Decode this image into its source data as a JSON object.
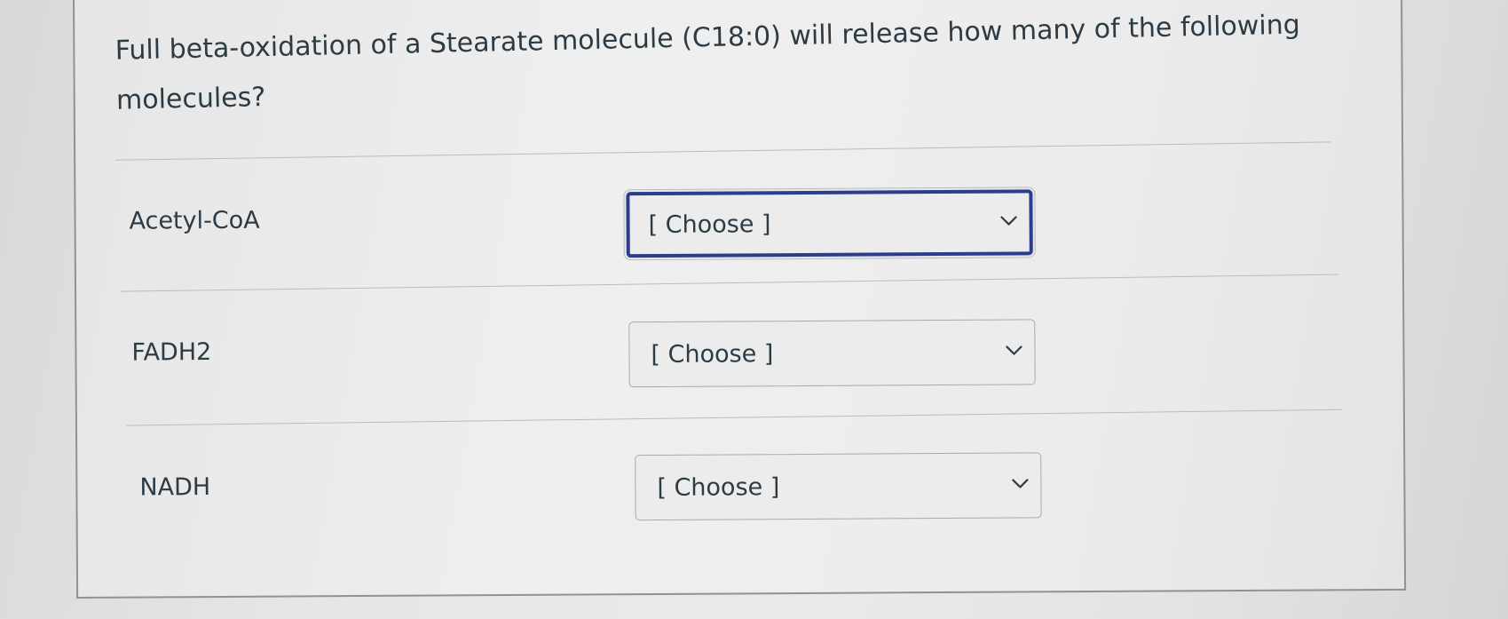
{
  "question": {
    "text": "Full beta-oxidation of a Stearate molecule (C18:0) will release how many of the following molecules?"
  },
  "rows": [
    {
      "label": "Acetyl-CoA",
      "select_value": "[ Choose ]",
      "icon": "chevron-down-icon",
      "focused": true
    },
    {
      "label": "FADH2",
      "select_value": "[ Choose ]",
      "icon": "chevron-down-icon",
      "focused": false
    },
    {
      "label": "NADH",
      "select_value": "[ Choose ]",
      "icon": "chevron-down-icon",
      "focused": false
    }
  ],
  "colors": {
    "text": "#2d3b45",
    "focus_border": "#2b3d8c",
    "select_border": "#a7aaad"
  }
}
